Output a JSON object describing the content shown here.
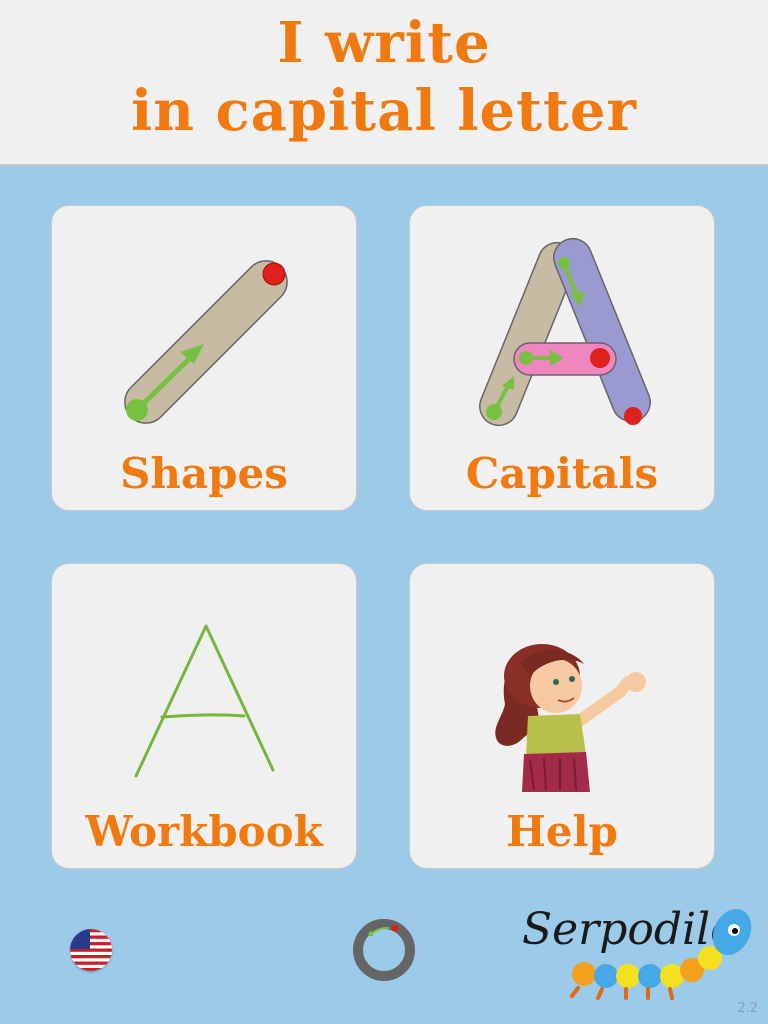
{
  "header": {
    "title_line1": "I write",
    "title_line2": "in capital letter"
  },
  "menu": {
    "shapes_label": "Shapes",
    "capitals_label": "Capitals",
    "workbook_label": "Workbook",
    "help_label": "Help"
  },
  "footer": {
    "logo_text": "Serpodile",
    "version": "2.2"
  },
  "icons": {
    "language": "us-flag-icon",
    "settings": "ring-icon"
  },
  "colors": {
    "accent": "#f07a10",
    "background": "#9ccbe9",
    "card": "#f0f0f0"
  }
}
